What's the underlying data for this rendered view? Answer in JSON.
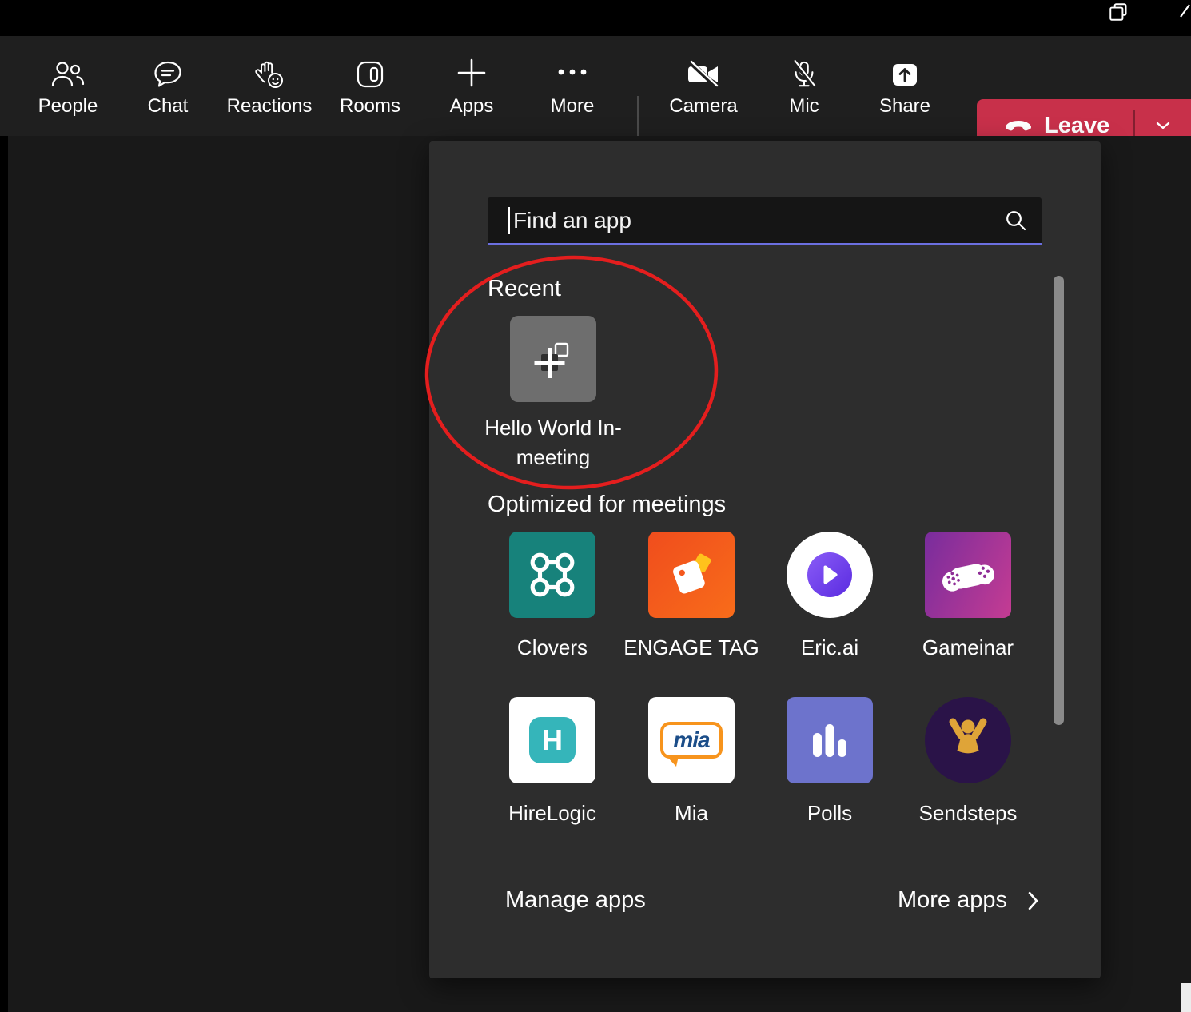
{
  "toolbar": {
    "items": [
      {
        "label": "People"
      },
      {
        "label": "Chat"
      },
      {
        "label": "Reactions"
      },
      {
        "label": "Rooms"
      },
      {
        "label": "Apps",
        "active": true
      },
      {
        "label": "More"
      },
      {
        "label": "Camera",
        "state": "off"
      },
      {
        "label": "Mic",
        "state": "off"
      },
      {
        "label": "Share"
      }
    ],
    "leave": {
      "label": "Leave"
    }
  },
  "apps_panel": {
    "search": {
      "placeholder": "Find an app",
      "value": ""
    },
    "sections": [
      {
        "title": "Recent",
        "apps": [
          {
            "name": "Hello World In-meeting",
            "icon": "default-app-icon"
          }
        ]
      },
      {
        "title": "Optimized for meetings",
        "apps": [
          {
            "name": "Clovers"
          },
          {
            "name": "ENGAGE TAG"
          },
          {
            "name": "Eric.ai"
          },
          {
            "name": "Gameinar"
          },
          {
            "name": "HireLogic"
          },
          {
            "name": "Mia"
          },
          {
            "name": "Polls"
          },
          {
            "name": "Sendsteps"
          }
        ]
      }
    ],
    "footer": {
      "manage_label": "Manage apps",
      "more_label": "More apps"
    }
  },
  "logos": {
    "hirelogic_letter": "H",
    "mia_text": "mia"
  },
  "annotation": {
    "shape": "ellipse",
    "color": "#e41e1e"
  },
  "colors": {
    "accent_purple": "#5b5fc7",
    "search_underline": "#6b6fe0",
    "leave_red": "#c8304a",
    "annotation_red": "#e41e1e",
    "panel_bg": "#2d2d2d",
    "recent_tile_gray": "#6e6e6e",
    "clovers_teal": "#17827b",
    "engage_orange": "#f4581d",
    "ericai_purple": "#6d3bee",
    "gameinar_purple": "#7c2d9c",
    "gameinar_magenta": "#c13b93",
    "polls_indigo": "#6d73cc",
    "sendsteps_purple": "#2a1348"
  },
  "icons": {
    "people-icon": "two-person-outline",
    "chat-icon": "speech-bubble-lines",
    "reactions-icon": "raised-hand-smiley",
    "rooms-icon": "breakout-rooms-square",
    "apps-icon": "plus",
    "more-icon": "ellipsis",
    "camera-off-icon": "camera-with-slash",
    "mic-off-icon": "microphone-with-slash",
    "share-icon": "arrow-up-in-box",
    "call-end-icon": "handset",
    "chevron-down-icon": "chevron-down",
    "chevron-right-icon": "chevron-right",
    "search-icon": "magnifier",
    "window-restore-icon": "overlapping-squares",
    "window-close-icon": "diagonal-cross-fragment",
    "default-app-icon": "blocks-with-plus"
  }
}
